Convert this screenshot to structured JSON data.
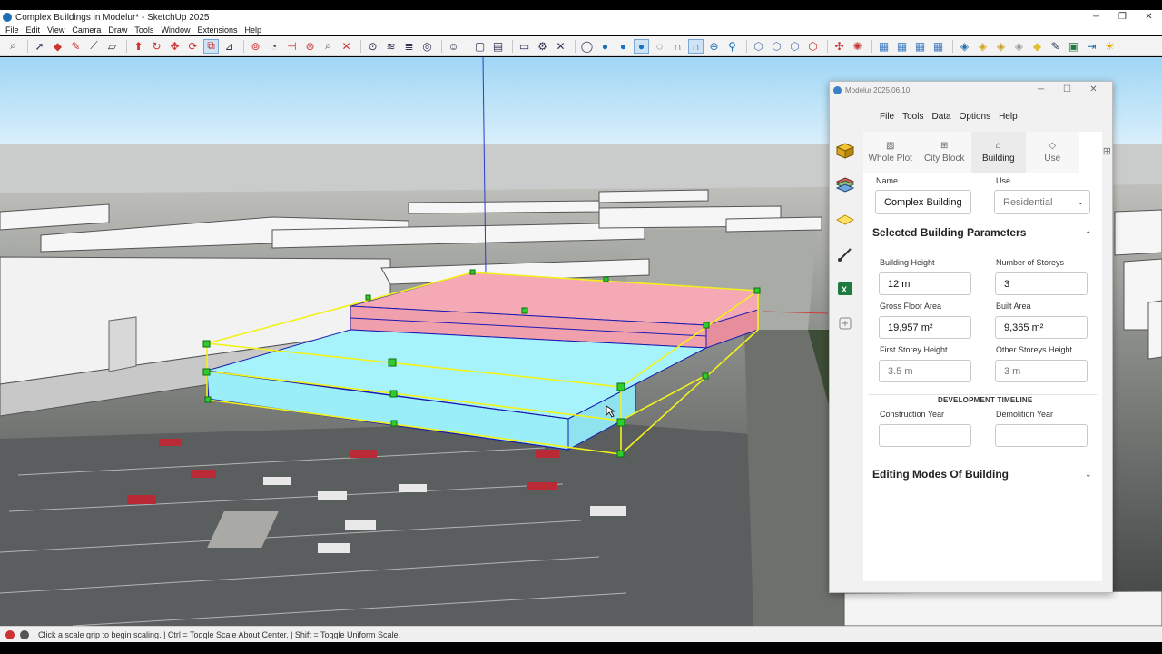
{
  "window": {
    "title": "Complex Buildings in Modelur* - SketchUp 2025"
  },
  "menu": [
    "File",
    "Edit",
    "View",
    "Camera",
    "Draw",
    "Tools",
    "Window",
    "Extensions",
    "Help"
  ],
  "status": {
    "message": "Click a scale grip to begin scaling. | Ctrl = Toggle Scale About Center. | Shift = Toggle Uniform Scale."
  },
  "panel": {
    "title": "Modelur 2025.06.10",
    "menu": [
      "File",
      "Tools",
      "Data",
      "Options",
      "Help"
    ],
    "tabs": [
      {
        "label": "Whole Plot",
        "icon": "image-icon"
      },
      {
        "label": "City Block",
        "icon": "grid-icon"
      },
      {
        "label": "Building",
        "icon": "home-icon"
      },
      {
        "label": "Use",
        "icon": "layers-icon"
      }
    ],
    "name_label": "Name",
    "name_value": "Complex Building",
    "use_label": "Use",
    "use_value": "Residential",
    "params_title": "Selected Building Parameters",
    "fields": {
      "building_height": {
        "label": "Building Height",
        "value": "12 m"
      },
      "storeys": {
        "label": "Number of Storeys",
        "value": "3"
      },
      "gfa": {
        "label": "Gross Floor Area",
        "value": "19,957 m²"
      },
      "built_area": {
        "label": "Built Area",
        "value": "9,365 m²"
      },
      "first_storey": {
        "label": "First Storey Height",
        "value": "3.5 m"
      },
      "other_storeys": {
        "label": "Other Storeys Height",
        "value": "3 m"
      }
    },
    "timeline_title": "DEVELOPMENT TIMELINE",
    "construction_label": "Construction Year",
    "construction_value": "",
    "demolition_label": "Demolition Year",
    "demolition_value": "",
    "editing_title": "Editing Modes Of Building"
  },
  "colors": {
    "accent": "#1b6fb5",
    "building_pink": "#f4a9b4",
    "building_cyan": "#a6f3fb",
    "selection_yellow": "#f2f21a"
  }
}
